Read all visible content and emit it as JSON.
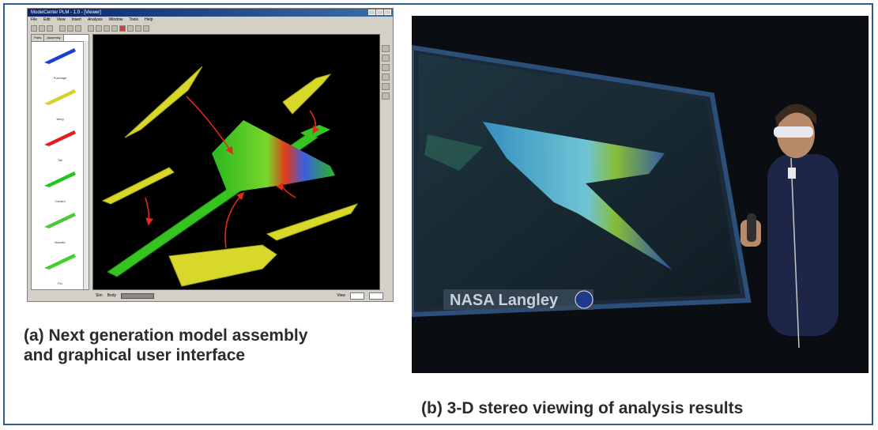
{
  "left_panel": {
    "app_title": "ModelCenter PLM - 1.0 - [Viewer]",
    "menu": [
      "File",
      "Edit",
      "View",
      "Insert",
      "Analysis",
      "Window",
      "Tools",
      "Help"
    ],
    "sidebar_tabs": [
      "Parts",
      "Assembly"
    ],
    "components": [
      {
        "name": "Fuselage",
        "color": "#1a3fd0"
      },
      {
        "name": "Wing",
        "color": "#d6d22a"
      },
      {
        "name": "Tail",
        "color": "#e02020"
      },
      {
        "name": "Canard",
        "color": "#22c41f"
      },
      {
        "name": "Nacelle",
        "color": "#4ec83a"
      },
      {
        "name": "Fin",
        "color": "#3fd02c"
      }
    ],
    "status": {
      "left": "Sim",
      "mid": "Body",
      "right": "View"
    },
    "caption": "(a)  Next generation model assembly\nand graphical user interface"
  },
  "right_panel": {
    "screen_label": "NASA Langley",
    "caption": "(b)  3-D stereo viewing of analysis results"
  },
  "colors": {
    "frame_border": "#2f5d8a",
    "part_yellow": "#d8d82a",
    "arrow_red": "#e02a1a",
    "aircraft_green": "#35c420"
  }
}
